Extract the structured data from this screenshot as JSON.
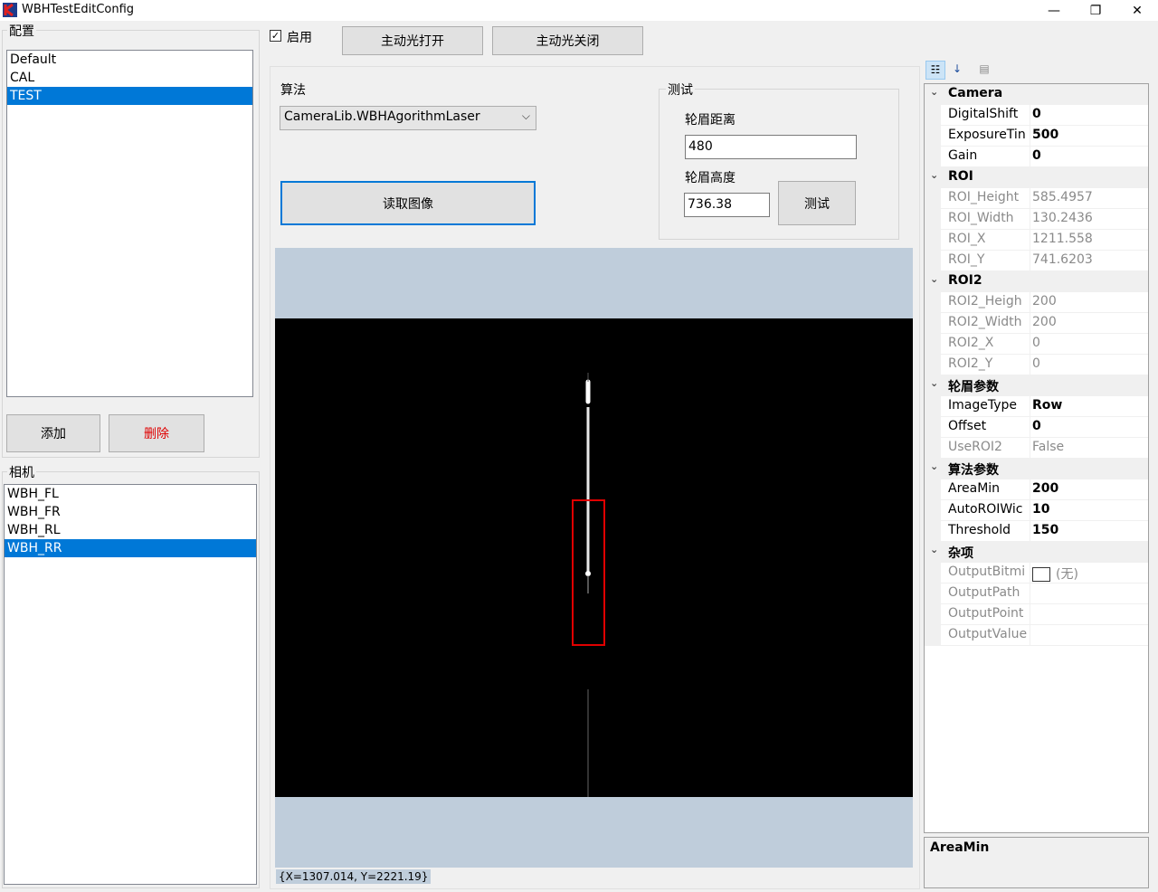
{
  "window": {
    "title": "WBHTestEditConfig",
    "controls": {
      "minimize": "—",
      "restore": "❐",
      "close": "✕"
    }
  },
  "config_group": {
    "label": "配置",
    "items": [
      "Default",
      "CAL",
      "TEST"
    ],
    "selected_index": 2,
    "add_label": "添加",
    "delete_label": "删除"
  },
  "camera_group": {
    "label": "相机",
    "items": [
      "WBH_FL",
      "WBH_FR",
      "WBH_RL",
      "WBH_RR"
    ],
    "selected_index": 3
  },
  "top_bar": {
    "enable_checkbox_label": "启用",
    "enable_checked": true,
    "light_on_label": "主动光打开",
    "light_off_label": "主动光关闭"
  },
  "algorithm": {
    "label": "算法",
    "selected": "CameraLib.WBHAgorithmLaser",
    "read_image_label": "读取图像"
  },
  "test_group": {
    "label": "测试",
    "distance_label": "轮眉距离",
    "distance_value": "480",
    "height_label": "轮眉高度",
    "height_value": "736.38",
    "test_button_label": "测试"
  },
  "viewer": {
    "coord_text": "{X=1307.014, Y=2221.19}"
  },
  "property_grid": {
    "rows": [
      {
        "type": "cat",
        "label": "Camera"
      },
      {
        "type": "prop",
        "name": "DigitalShift",
        "value": "0",
        "bold": true
      },
      {
        "type": "prop",
        "name": "ExposureTin",
        "value": "500",
        "bold": true
      },
      {
        "type": "prop",
        "name": "Gain",
        "value": "0",
        "bold": true
      },
      {
        "type": "cat",
        "label": "ROI"
      },
      {
        "type": "prop",
        "name": "ROI_Height",
        "value": "585.4957",
        "gray": true
      },
      {
        "type": "prop",
        "name": "ROI_Width",
        "value": "130.2436",
        "gray": true
      },
      {
        "type": "prop",
        "name": "ROI_X",
        "value": "1211.558",
        "gray": true
      },
      {
        "type": "prop",
        "name": "ROI_Y",
        "value": "741.6203",
        "gray": true
      },
      {
        "type": "cat",
        "label": "ROI2"
      },
      {
        "type": "prop",
        "name": "ROI2_Heigh",
        "value": "200",
        "gray": true
      },
      {
        "type": "prop",
        "name": "ROI2_Width",
        "value": "200",
        "gray": true
      },
      {
        "type": "prop",
        "name": "ROI2_X",
        "value": "0",
        "gray": true
      },
      {
        "type": "prop",
        "name": "ROI2_Y",
        "value": "0",
        "gray": true
      },
      {
        "type": "cat",
        "label": "轮眉参数"
      },
      {
        "type": "prop",
        "name": "ImageType",
        "value": "Row",
        "bold": true
      },
      {
        "type": "prop",
        "name": "Offset",
        "value": "0",
        "bold": true
      },
      {
        "type": "prop",
        "name": "UseROI2",
        "value": "False",
        "gray": true
      },
      {
        "type": "cat",
        "label": "算法参数"
      },
      {
        "type": "prop",
        "name": "AreaMin",
        "value": "200",
        "bold": true
      },
      {
        "type": "prop",
        "name": "AutoROIWic",
        "value": "10",
        "bold": true
      },
      {
        "type": "prop",
        "name": "Threshold",
        "value": "150",
        "bold": true
      },
      {
        "type": "cat",
        "label": "杂项"
      },
      {
        "type": "prop",
        "name": "OutputBitmi",
        "value": "(无)",
        "gray": true,
        "swatch": true
      },
      {
        "type": "prop",
        "name": "OutputPath",
        "value": "",
        "gray": true
      },
      {
        "type": "prop",
        "name": "OutputPoint",
        "value": "",
        "gray": true
      },
      {
        "type": "prop",
        "name": "OutputValue",
        "value": "",
        "gray": true
      }
    ],
    "description_title": "AreaMin"
  },
  "colors": {
    "selection": "#0078d7",
    "viewer_bg": "#bfcddb",
    "roi_rect": "#e00000"
  }
}
